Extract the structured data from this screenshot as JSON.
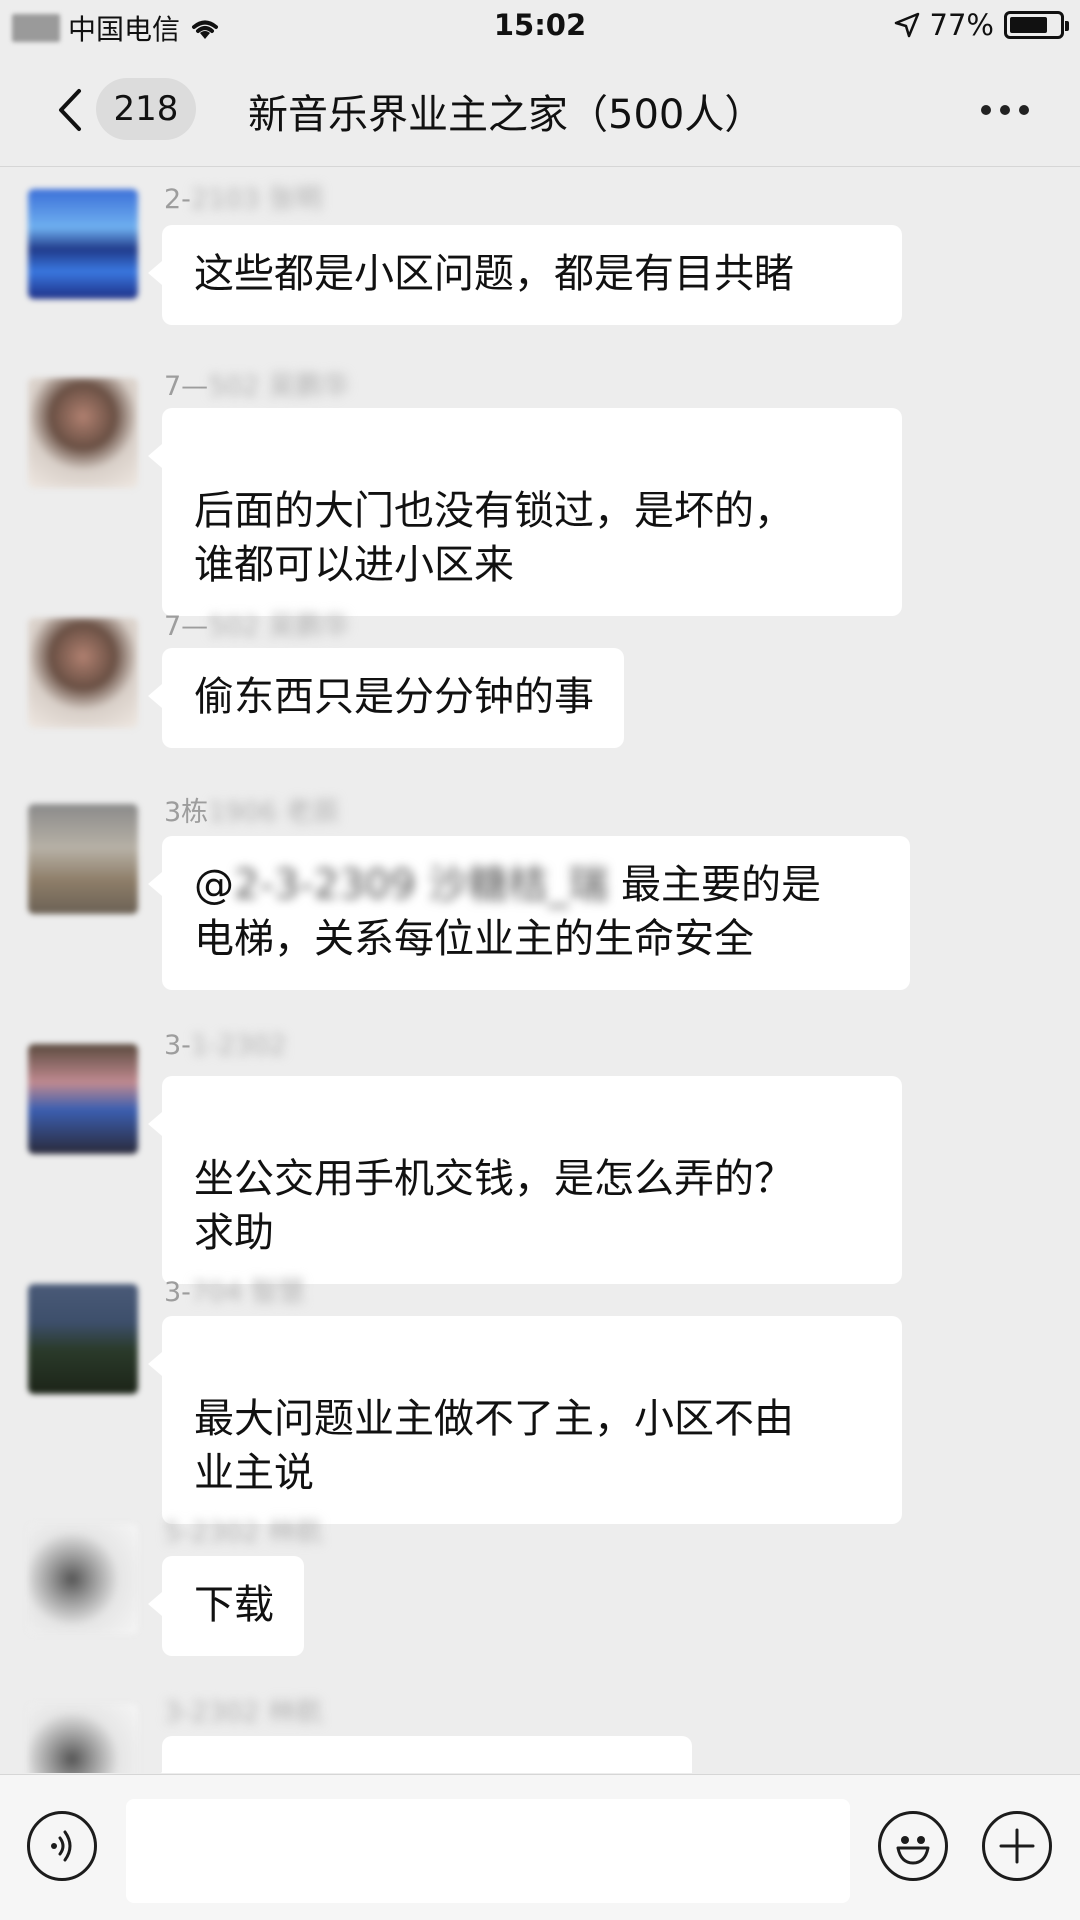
{
  "status_bar": {
    "carrier": "中国电信",
    "time": "15:02",
    "battery_text": "77%",
    "battery_level": 0.77
  },
  "nav": {
    "unread_count": "218",
    "title": "新音乐界业主之家（500人）"
  },
  "messages": [
    {
      "sender_prefix": "2-",
      "sender_blurred": "2103 张明",
      "text": "这些都是小区问题，都是有目共睹"
    },
    {
      "sender_prefix": "7—",
      "sender_blurred": "502 吴鹏华",
      "text": "后面的大门也没有锁过，是坏的，\n谁都可以进小区来"
    },
    {
      "sender_prefix": "7—",
      "sender_blurred": "502 吴鹏华",
      "text": "偷东西只是分分钟的事"
    },
    {
      "sender_prefix": "3栋",
      "sender_blurred": "1906 老辰",
      "mention": "@",
      "mention_blurred": "2-3-2309 沙糖桔_瑞",
      "text_after_mention": " 最主要的是",
      "text_line2": "电梯，关系每位业主的生命安全"
    },
    {
      "sender_prefix": "3-",
      "sender_blurred": "1-2302",
      "text": "坐公交用手机交钱，是怎么弄的？\n求助"
    },
    {
      "sender_prefix": "3-",
      "sender_blurred": "704 智慧",
      "text": "最大问题业主做不了主，小区不由\n业主说"
    },
    {
      "sender_prefix": "",
      "sender_blurred": "5-2302 林航",
      "text": "下载"
    },
    {
      "sender_prefix": "",
      "sender_blurred": "3-2302 林航",
      "text": ""
    }
  ],
  "icons": {
    "back": "chevron-left-icon",
    "more": "more-dots-icon",
    "voice": "voice-icon",
    "emoji": "emoji-icon",
    "plus": "plus-icon",
    "wifi": "wifi-icon",
    "location": "location-arrow-icon"
  },
  "input": {
    "value": "",
    "placeholder": ""
  }
}
